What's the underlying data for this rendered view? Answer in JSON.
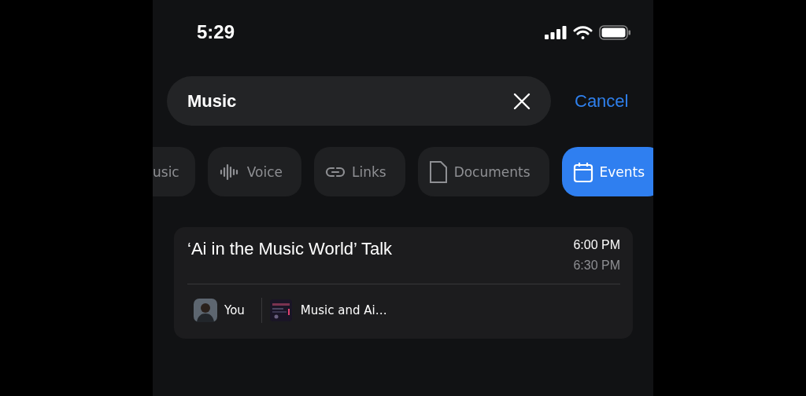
{
  "status_bar": {
    "time": "5:29"
  },
  "search": {
    "value": "Music",
    "cancel": "Cancel"
  },
  "filters": [
    {
      "label": "usic",
      "selected": false
    },
    {
      "label": "Voice",
      "selected": false
    },
    {
      "label": "Links",
      "selected": false
    },
    {
      "label": "Documents",
      "selected": false
    },
    {
      "label": "Events",
      "selected": true
    }
  ],
  "results": [
    {
      "title": "‘Ai in the Music World’ Talk",
      "start": "6:00 PM",
      "end": "6:30 PM",
      "attendee": "You",
      "source": "Music and Ai…"
    }
  ]
}
